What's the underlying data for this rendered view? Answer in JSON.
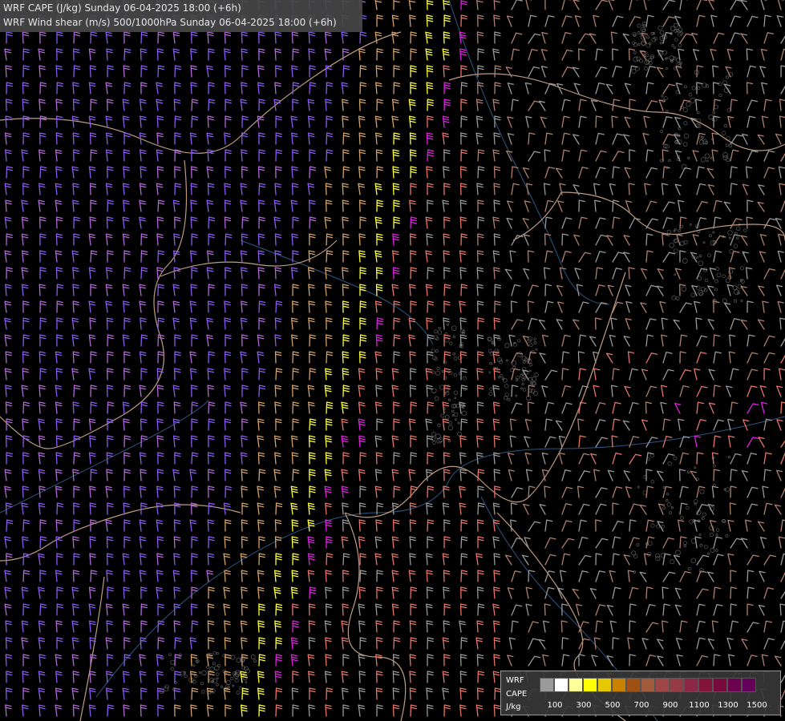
{
  "header": {
    "line1": "WRF CAPE (J/kg) Sunday 06-04-2025 18:00 (+6h)",
    "line2": "WRF Wind shear (m/s) 500/1000hPa Sunday 06-04-2025 18:00 (+6h)"
  },
  "legend": {
    "title": "WRF",
    "variable": "CAPE",
    "unit": "J/kg",
    "swatch_colors": [
      "#9a9a9a",
      "#ffffff",
      "#ffff9a",
      "#ffff00",
      "#e6c800",
      "#c88200",
      "#a05014",
      "#a05a3c",
      "#a04646",
      "#963c46",
      "#8c2846",
      "#82143c",
      "#780a3c",
      "#6e0050",
      "#64005a"
    ],
    "tick_labels": [
      "100",
      "300",
      "500",
      "700",
      "900",
      "1100",
      "1300",
      "1500"
    ]
  },
  "map": {
    "colors": {
      "background": "#000000",
      "border": "#e0b89c",
      "river": "#3a6ea5",
      "terrain": "#9a9a9a",
      "barb_purple": "#8a5cf0",
      "barb_lilac": "#b06ad8",
      "barb_tan": "#d4a26a",
      "barb_yellow": "#ffff3c",
      "barb_salmon": "#e8766a",
      "barb_magenta": "#e020e0",
      "barb_grey": "#9a9a9a"
    }
  }
}
